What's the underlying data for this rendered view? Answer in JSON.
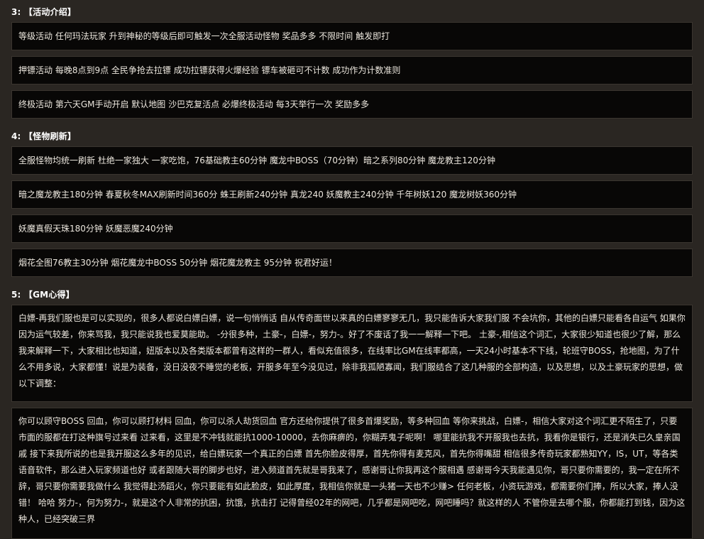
{
  "sections": [
    {
      "heading": "3: 【活动介绍】",
      "items": [
        "等级活动 任何玛法玩家 升到神秘的等级后即可触发一次全服活动怪物 奖品多多 不限时间 触发即打",
        "押镖活动 每晚8点到9点 全民争抢去拉镖 成功拉镖获得火爆经验 镖车被砸可不计数 成功作为计数准则",
        "终极活动 第六天GM手动开启 默认地图 沙巴克复活点 必爆终极活动 每3天举行一次 奖励多多"
      ]
    },
    {
      "heading": "4: 【怪物刷新】",
      "items": [
        "全服怪物均统一刷新 杜绝一家独大 一家吃饱，76基础教主60分钟 魔龙中BOSS（70分钟）暗之系列80分钟 魔龙教主120分钟",
        "暗之魔龙教主180分钟 春夏秋冬MAX刷新时间360分 蛛王刷新240分钟 真龙240 妖魔教主240分钟 千年树妖120 魔龙树妖360分钟",
        "妖魔真假天珠180分钟 妖魔恶魔240分钟",
        "烟花全图76教主30分钟 烟花魔龙中BOSS 50分钟 烟花魔龙教主 95分钟 祝君好运！"
      ]
    },
    {
      "heading": "5: 【GM心得】",
      "paragraphs": [
        "白嫖-再我们服也是可以实现的，很多人都说白嫖白嫖，说一句悄悄话 自从传奇面世以来真的白嫖寥寥无几，我只能告诉大家我们服 不会坑你，其他的白嫖只能看各自运气 如果你因为运气较差，你来骂我，我只能说我也爱莫能助。 -分很多种，土豪-，白嫖-，努力-。好了不废话了我一一解释一下吧。 土豪-,相信这个词汇，大家很少知道也很少了解，那么我来解释一下，大家相比也知道，妞版本以及各类版本都曾有这样的一群人，看似充值很多，在线率比GM在线率都高，一天24小时基本不下线，轮班守BOSS，抢地图，为了什么不用多说，大家都懂！说是为装备，没日没夜不睡觉的老板，开服多年至今没见过，除非我孤陋寡闻，我们服结合了这几种服的全部构造，以及思想，以及土豪玩家的思想，做以下调整：",
        "你可以顾守BOSS 回血，你可以顾打材料 回血，你可以杀人劫货回血 官方还给你提供了很多首爆奖励，等多种回血 等你来挑战，白嫖-，相信大家对这个词汇更不陌生了，只要市面的服都在打这种旗号过来看 过来看，这里是不冲钱就能抗1000-10000，去你麻痹的，你糊弄鬼子呢啊！ 哪里能抗我不开服我也去抗，我看你是银行，还是消失已久皇亲国戚 接下来我所说的也是我开服这么多年的见识，给白嫖玩家一个真正的白嫖 首先你脸皮得厚，首先你得有麦克风，首先你得嘴甜 相信很多传奇玩家都熟知YY，IS，UT，等各类语音软件，那么进入玩家频道也好 或者跟随大哥的脚步也好，进入频道首先就是哥我来了，感谢哥让你我再这个服相遇 感谢哥今天我能遇见你，哥只要你需要的，我一定在所不辞，哥只要你需要我做什么 我觉得赴汤蹈火，你只要能有如此脸皮，如此厚度，我相信你就是一头猪一天也不少赚> 任何老板，小资玩游戏，都需要你们捧，所以大家，捧人没错！ 哈哈 努力-，何为努力-，就是这个人非常的抗困，抗饿，抗击打 记得曾经02年的网吧，几乎都是网吧吃，网吧睡吗？就这样的人 不管你是去哪个服，你都能打到钱，因为这种人，已经突破三界"
      ]
    }
  ]
}
